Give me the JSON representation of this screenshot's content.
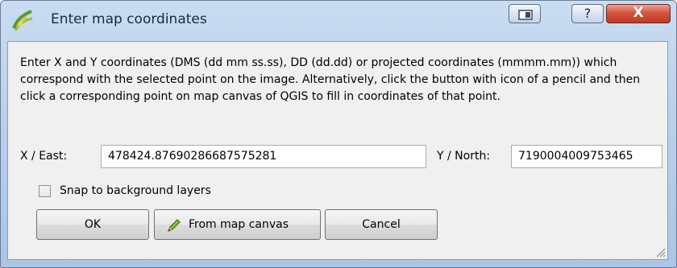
{
  "window": {
    "title": "Enter map coordinates",
    "icon": "qgis-icon",
    "controls": {
      "restore": "restore-icon",
      "help": "?",
      "close": "X"
    }
  },
  "instructions": "Enter X and Y coordinates (DMS (dd mm ss.ss), DD (dd.dd) or projected coordinates (mmmm.mm)) which correspond with the selected point on the image. Alternatively, click the button with icon of a pencil and then click a corresponding point on map canvas of QGIS to fill in coordinates of that point.",
  "x_field": {
    "label": "X / East:",
    "value": "478424.87690286687575281"
  },
  "y_field": {
    "label": "Y / North:",
    "value": "7190004009753465"
  },
  "snap": {
    "label": "Snap to background layers",
    "checked": false
  },
  "buttons": {
    "ok": "OK",
    "from_map_canvas": "From map canvas",
    "cancel": "Cancel"
  },
  "colors": {
    "close_button": "#c13a22",
    "titlebar": "#b9d0ec",
    "client": "#f0f0f0"
  }
}
